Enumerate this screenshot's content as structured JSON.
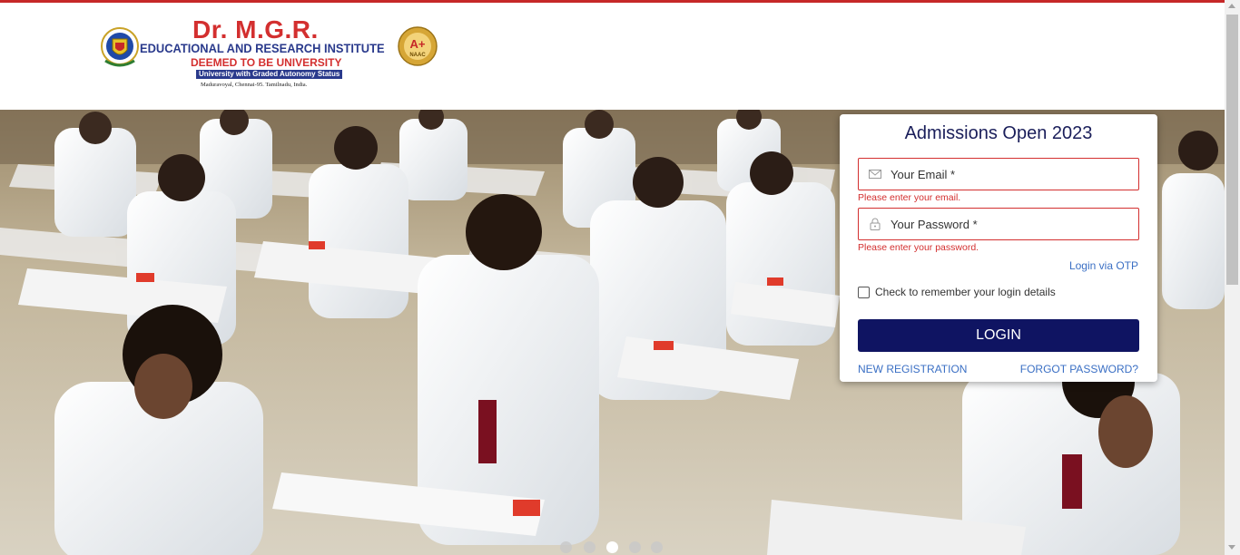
{
  "header": {
    "logo": {
      "title": "Dr. M.G.R.",
      "line1": "EDUCATIONAL AND RESEARCH INSTITUTE",
      "line2": "DEEMED TO BE UNIVERSITY",
      "line3": "University with Graded Autonomy Status",
      "address": "Maduravoyal, Chennai-95. Tamilnadu, India.",
      "naac_grade": "A+",
      "naac_label": "NAAC"
    }
  },
  "login": {
    "title": "Admissions Open 2023",
    "email_placeholder": "Your Email *",
    "email_error": "Please enter your email.",
    "password_placeholder": "Your Password *",
    "password_error": "Please enter your password.",
    "otp_link": "Login via OTP",
    "remember_label": "Check to remember your login details",
    "remember_checked": false,
    "login_button": "LOGIN",
    "register_link": "NEW REGISTRATION",
    "forgot_link": "FORGOT PASSWORD?"
  },
  "carousel": {
    "slide_count": 5,
    "active_index": 2
  },
  "colors": {
    "accent_red": "#c62828",
    "navy": "#0f1462",
    "link_blue": "#3a6fc4",
    "error_red": "#d32f2f"
  },
  "icons": {
    "email": "envelope-icon",
    "password": "lock-icon"
  }
}
